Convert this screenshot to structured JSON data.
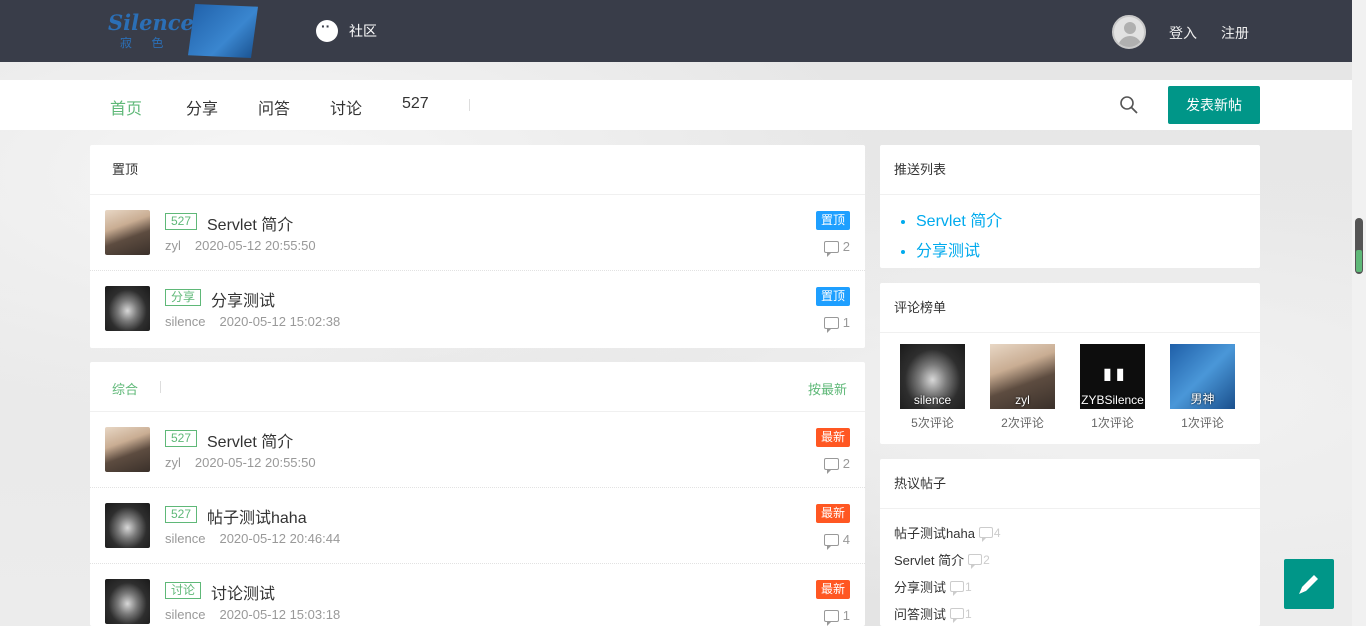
{
  "header": {
    "logo_text": "Silence",
    "logo_sub": "寂 色",
    "community": "社区",
    "login": "登入",
    "register": "注册"
  },
  "nav": {
    "items": [
      "首页",
      "分享",
      "问答",
      "讨论",
      "527"
    ],
    "post_button": "发表新帖"
  },
  "pinned": {
    "title": "置顶",
    "posts": [
      {
        "tag": "527",
        "title": "Servlet 简介",
        "author": "zyl",
        "time": "2020-05-12 20:55:50",
        "badge": "置顶",
        "comments": "2"
      },
      {
        "tag": "分享",
        "title": "分享测试",
        "author": "silence",
        "time": "2020-05-12 15:02:38",
        "badge": "置顶",
        "comments": "1"
      }
    ]
  },
  "latest": {
    "tab": "综合",
    "sort": "按最新",
    "posts": [
      {
        "tag": "527",
        "title": "Servlet 简介",
        "author": "zyl",
        "time": "2020-05-12 20:55:50",
        "badge": "最新",
        "comments": "2"
      },
      {
        "tag": "527",
        "title": "帖子测试haha",
        "author": "silence",
        "time": "2020-05-12 20:46:44",
        "badge": "最新",
        "comments": "4"
      },
      {
        "tag": "讨论",
        "title": "讨论测试",
        "author": "silence",
        "time": "2020-05-12 15:03:18",
        "badge": "最新",
        "comments": "1"
      }
    ]
  },
  "push": {
    "title": "推送列表",
    "items": [
      "Servlet 简介",
      "分享测试"
    ]
  },
  "ranking": {
    "title": "评论榜单",
    "users": [
      {
        "name": "silence",
        "count": "5次评论"
      },
      {
        "name": "zyl",
        "count": "2次评论"
      },
      {
        "name": "ZYBSilence",
        "count": "1次评论"
      },
      {
        "name": "男神",
        "count": "1次评论"
      }
    ]
  },
  "hot": {
    "title": "热议帖子",
    "items": [
      {
        "title": "帖子测试haha",
        "count": "4"
      },
      {
        "title": "Servlet 简介",
        "count": "2"
      },
      {
        "title": "分享测试",
        "count": "1"
      },
      {
        "title": "问答测试",
        "count": "1"
      }
    ]
  },
  "colors": {
    "header_bg": "#393d49",
    "accent_green": "#5fb878",
    "button_teal": "#009688",
    "badge_top": "#1e9fff",
    "badge_new": "#ff5722",
    "link_blue": "#01aaed"
  }
}
